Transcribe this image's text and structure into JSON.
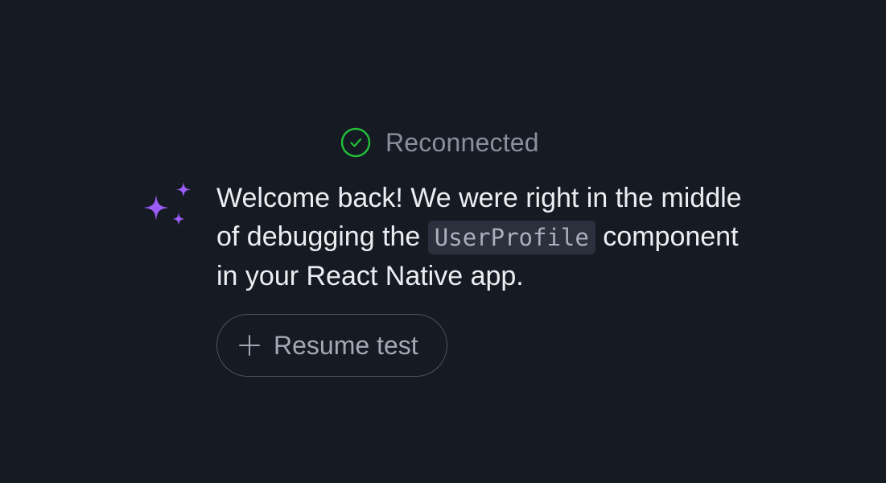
{
  "status": {
    "label": "Reconnected",
    "icon": "check-circle-icon",
    "color": "#22c03a"
  },
  "assistant": {
    "icon": "sparkle-icon",
    "icon_color": "#9a5cf5",
    "message": {
      "before": "Welcome back! We were right in the middle of debugging the ",
      "code": "UserProfile",
      "after": " component in your React Native app."
    }
  },
  "actions": {
    "resume": {
      "label": "Resume test",
      "icon": "plus-icon"
    }
  }
}
